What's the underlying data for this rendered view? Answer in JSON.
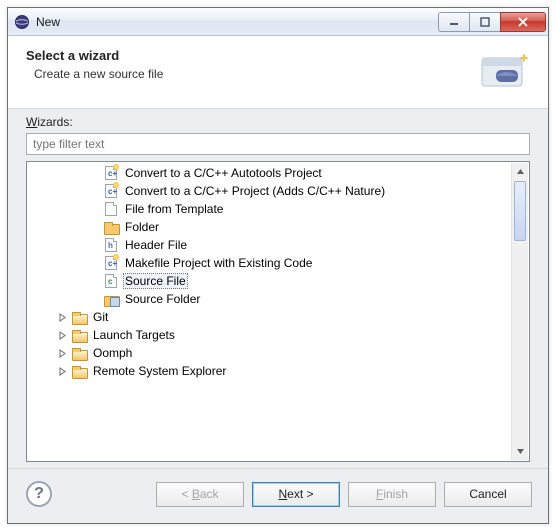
{
  "window": {
    "title": "New"
  },
  "header": {
    "title": "Select a wizard",
    "subtitle": "Create a new source file"
  },
  "body": {
    "wizards_label_ul": "W",
    "wizards_label_rest": "izards:",
    "filter_placeholder": "type filter text"
  },
  "tree": [
    {
      "indent": 3,
      "twisty": "none",
      "icon": "cpp-file-star",
      "label": "Convert to a C/C++ Autotools Project",
      "selected": false
    },
    {
      "indent": 3,
      "twisty": "none",
      "icon": "cpp-file-star",
      "label": "Convert to a C/C++ Project (Adds C/C++ Nature)",
      "selected": false
    },
    {
      "indent": 3,
      "twisty": "none",
      "icon": "file",
      "label": "File from Template",
      "selected": false
    },
    {
      "indent": 3,
      "twisty": "none",
      "icon": "folder",
      "label": "Folder",
      "selected": false
    },
    {
      "indent": 3,
      "twisty": "none",
      "icon": "h-file",
      "label": "Header File",
      "selected": false
    },
    {
      "indent": 3,
      "twisty": "none",
      "icon": "cpp-file-star",
      "label": "Makefile Project with Existing Code",
      "selected": false
    },
    {
      "indent": 3,
      "twisty": "none",
      "icon": "c-file",
      "label": "Source File",
      "selected": true
    },
    {
      "indent": 3,
      "twisty": "none",
      "icon": "src-folder",
      "label": "Source Folder",
      "selected": false
    },
    {
      "indent": 1,
      "twisty": "closed",
      "icon": "folder-open",
      "label": "Git",
      "selected": false
    },
    {
      "indent": 1,
      "twisty": "closed",
      "icon": "folder-open",
      "label": "Launch Targets",
      "selected": false
    },
    {
      "indent": 1,
      "twisty": "closed",
      "icon": "folder-open",
      "label": "Oomph",
      "selected": false
    },
    {
      "indent": 1,
      "twisty": "closed",
      "icon": "folder-open",
      "label": "Remote System Explorer",
      "selected": false
    }
  ],
  "buttons": {
    "back_prefix": "< ",
    "back_ul": "B",
    "back_rest": "ack",
    "next_ul": "N",
    "next_rest": "ext >",
    "finish_ul": "F",
    "finish_rest": "inish",
    "cancel": "Cancel"
  }
}
